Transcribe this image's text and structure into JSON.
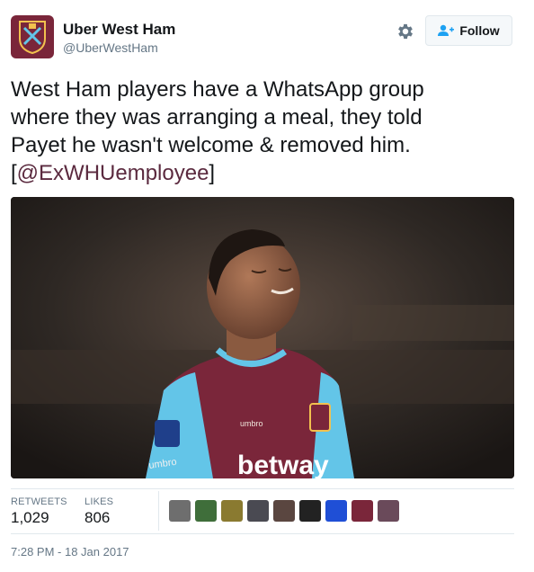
{
  "header": {
    "display_name": "Uber West Ham",
    "handle": "@UberWestHam",
    "follow_label": "Follow",
    "avatar_icon": "west-ham-crest-icon",
    "settings_icon": "gear-icon"
  },
  "tweet": {
    "lines": [
      "West Ham players have a WhatsApp group",
      "where they was arranging a meal, they told",
      "Payet he wasn't welcome & removed him."
    ],
    "open_bracket": "[",
    "mention": "@ExWHUemployee",
    "close_bracket": "]"
  },
  "photo": {
    "shirt_sponsor": "betway",
    "sleeve_text": "umbro"
  },
  "stats": {
    "retweets_label": "RETWEETS",
    "retweets_value": "1,029",
    "likes_label": "LIKES",
    "likes_value": "806"
  },
  "timestamp": "7:28 PM - 18 Jan 2017",
  "colors": {
    "claret": "#7a263a",
    "sky_blue": "#63c5e8",
    "link": "#5b2a3f"
  }
}
